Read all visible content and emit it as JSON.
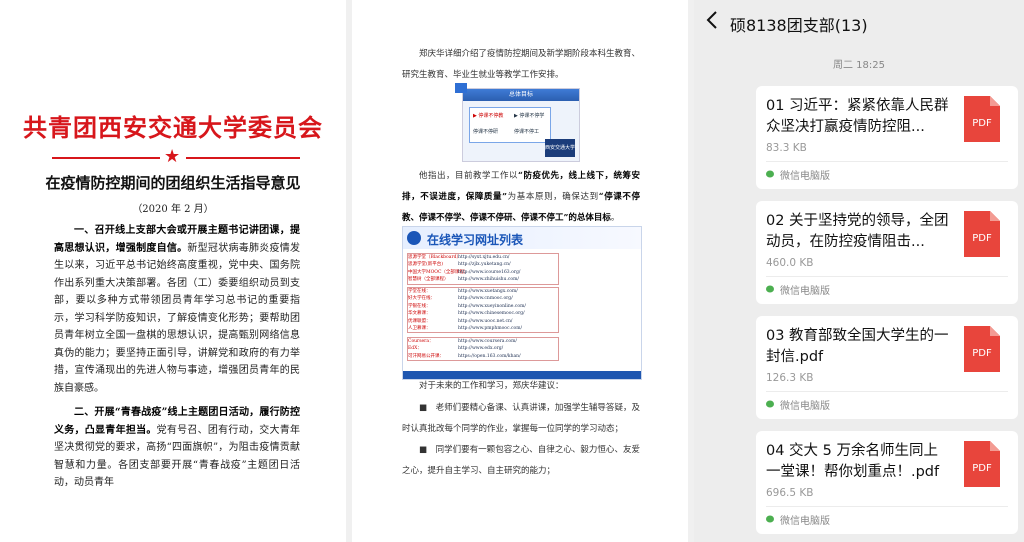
{
  "doc1": {
    "title": "共青团西安交通大学委员会",
    "star": "★",
    "subtitle": "在疫情防控期间的团组织生活指导意见",
    "date": "（2020 年 2 月）",
    "para1_bold": "一、召开线上支部大会或开展主题书记讲团课，提高思想认识，增强制度自信。",
    "para1_text": "新型冠状病毒肺炎疫情发生以来，习近平总书记始终高度重视，党中央、国务院作出系列重大决策部署。各团（工）委要组织动员到支部，要以多种方式带领团员青年学习总书记的重要指示，学习科学防疫知识，了解疫情变化形势；要帮助团员青年树立全国一盘棋的思想认识，提高甄别网络信息真伪的能力；要坚持正面引导，讲解党和政府的有力举措，宣传涌现出的先进人物与事迹，增强团员青年的民族自豪感。",
    "para2_bold": "二、开展“青春战疫”线上主题团日活动，履行防控义务，凸显青年担当。",
    "para2_text": "党有号召、团有行动，交大青年坚决贯彻党的要求，高扬“四面旗帜”，为阻击疫情贡献智慧和力量。各团支部要开展“青春战疫”主题团日活动，动员青年"
  },
  "doc2": {
    "intro": "郑庆华详细介绍了疫情防控期间及新学期阶段本科生教育、研究生教育、毕业生就业等教学工作安排。",
    "slide": {
      "head": "总体目标",
      "item1": "▶ 停课不停教",
      "item2": "▶ 停课不停学",
      "item3": "停课不停研",
      "item4": "停课不停工",
      "logo": "西安交通大学"
    },
    "body_prefix": "他指出，目前教学工作以",
    "body_b1": "“防疫优先，线上线下，统筹安排，不误进度，保障质量”",
    "body_mid": "为基本原则，确保达到",
    "body_b2": "“停课不停教、停课不停学、停课不停研、停课不停工”的总体目标",
    "body_end": "。",
    "weblist": {
      "title": "在线学习网址列表",
      "rows_a": [
        [
          "思源学堂（Blackboard）",
          "http://syxt.xjtu.edu.cn/"
        ],
        [
          "思源学堂(新平台)",
          "http://zjlx.yuketang.cn/"
        ],
        [
          "中国大学MOOC（全部课程）",
          "http://www.icourse163.org/"
        ],
        [
          "智慧树（全部课程）",
          "http://www.zhihuishu.com/"
        ]
      ],
      "rows_b": [
        [
          "学堂在线：",
          "http://www.xuetangx.com/"
        ],
        [
          "好大学在线：",
          "http://www.cnmooc.org/"
        ],
        [
          "学银在线：",
          "http://www.xueyinonline.com/"
        ],
        [
          "华文慕课：",
          "http://www.chinesemooc.org/"
        ],
        [
          "优课联盟：",
          "http://www.uooc.net.cn/"
        ],
        [
          "人卫慕课：",
          "http://www.pmphmooc.com/"
        ]
      ],
      "rows_c": [
        [
          "Coursera：",
          "http://www.coursera.com/"
        ],
        [
          "EdX：",
          "http://www.edx.org/"
        ],
        [
          "可汗网易公开课：",
          "https://open.163.com/khan/"
        ]
      ]
    },
    "advice_intro": "对于未来的工作和学习，郑庆华建议：",
    "advice1": "■　老师们要精心备课、认真讲课，加强学生辅导答疑，及时认真批改每个同学的作业，掌握每一位同学的学习动态；",
    "advice2": "■　同学们要有一颗包容之心、自律之心、毅力恒心、友爱之心，提升自主学习、自主研究的能力；"
  },
  "chat": {
    "back_icon": "chevron-left-icon",
    "title": "硕8138团支部(13)",
    "time": "周二 18:25",
    "pdf_label": "PDF",
    "files": [
      {
        "name": "01 习近平：紧紧依靠人民群众坚决打赢疫情防控阻...",
        "size": "83.3 KB",
        "source": "微信电脑版"
      },
      {
        "name": "02 关于坚持党的领导，全团动员，在防控疫情阻击...",
        "size": "460.0 KB",
        "source": "微信电脑版"
      },
      {
        "name": "03 教育部致全国大学生的一封信.pdf",
        "size": "126.3 KB",
        "source": "微信电脑版"
      },
      {
        "name": "04 交大 5 万余名师生同上一堂课！帮你划重点！.pdf",
        "size": "696.5 KB",
        "source": "微信电脑版"
      }
    ],
    "colors": {
      "pdf": "#e8453c",
      "source_icon": "#4caf50",
      "background": "#ededed"
    }
  }
}
